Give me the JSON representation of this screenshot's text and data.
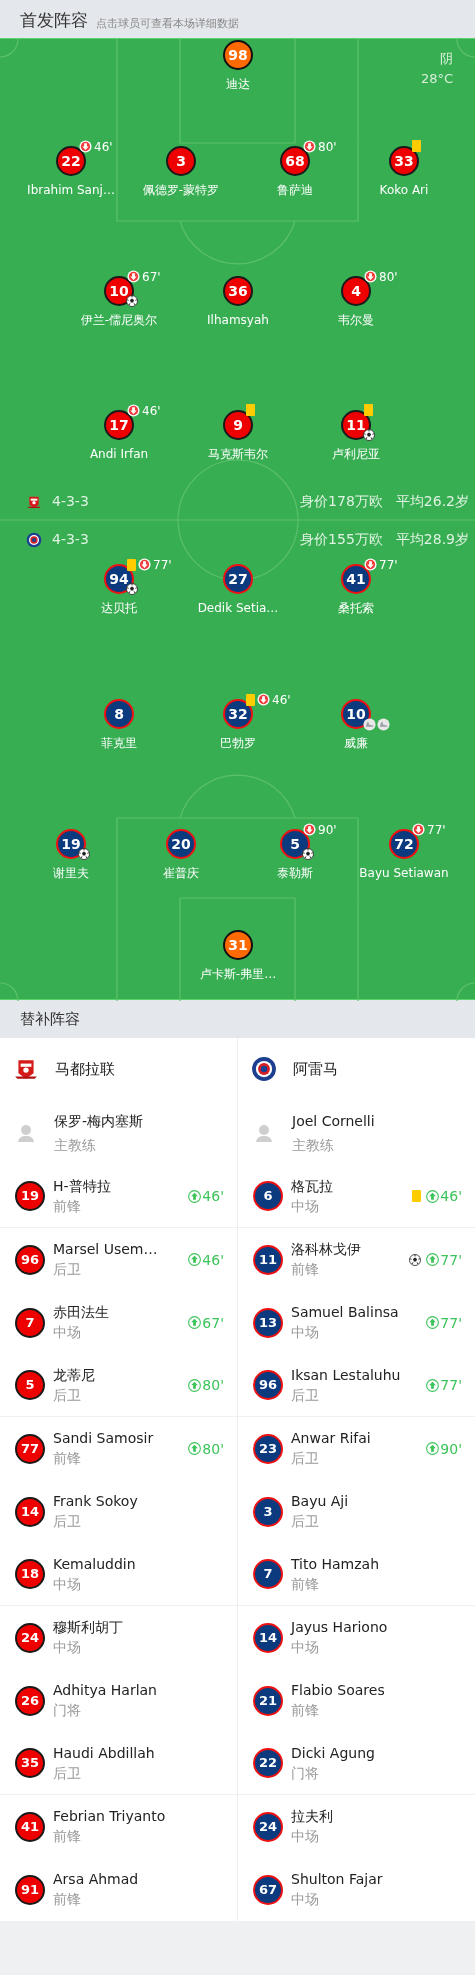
{
  "header": {
    "title": "首发阵容",
    "subtitle": "点击球员可查看本场详细数据"
  },
  "pitch": {
    "weather": "阴",
    "temperature": "28°C",
    "teams": [
      {
        "kind": "home",
        "formation": "4-3-3",
        "value": "身价178万欧",
        "age": "平均26.2岁",
        "lines": [
          {
            "players": [
              {
                "number": "98",
                "name": "迪达",
                "goalkeeper": true
              }
            ]
          },
          {
            "players": [
              {
                "number": "22",
                "name": "Ibrahim Sanj…",
                "goalkeeper": false,
                "events": [
                  {
                    "kind": "sub_out",
                    "minute": "46'"
                  }
                ]
              },
              {
                "number": "3",
                "name": "佩德罗-蒙特罗",
                "goalkeeper": false
              },
              {
                "number": "68",
                "name": "鲁萨迪",
                "goalkeeper": false,
                "events": [
                  {
                    "kind": "sub_out",
                    "minute": "80'"
                  }
                ]
              },
              {
                "number": "33",
                "name": "Koko Ari",
                "goalkeeper": false,
                "events": [
                  {
                    "kind": "yellow"
                  }
                ]
              }
            ]
          },
          {
            "players": [
              {
                "number": "10",
                "name": "伊兰-儒尼奥尔",
                "goalkeeper": false,
                "events": [
                  {
                    "kind": "sub_out",
                    "minute": "67'"
                  },
                  {
                    "kind": "goal"
                  }
                ]
              },
              {
                "number": "36",
                "name": "Ilhamsyah",
                "goalkeeper": false
              },
              {
                "number": "4",
                "name": "韦尔曼",
                "goalkeeper": false,
                "events": [
                  {
                    "kind": "sub_out",
                    "minute": "80'"
                  }
                ]
              }
            ]
          },
          {
            "players": [
              {
                "number": "17",
                "name": "Andi Irfan",
                "goalkeeper": false,
                "events": [
                  {
                    "kind": "sub_out",
                    "minute": "46'"
                  }
                ]
              },
              {
                "number": "9",
                "name": "马克斯韦尔",
                "goalkeeper": false,
                "events": [
                  {
                    "kind": "yellow"
                  }
                ]
              },
              {
                "number": "11",
                "name": "卢利尼亚",
                "goalkeeper": false,
                "events": [
                  {
                    "kind": "yellow"
                  },
                  {
                    "kind": "goal"
                  }
                ]
              }
            ]
          }
        ]
      },
      {
        "kind": "away",
        "formation": "4-3-3",
        "value": "身价155万欧",
        "age": "平均28.9岁",
        "lines": [
          {
            "players": [
              {
                "number": "94",
                "name": "达贝托",
                "goalkeeper": false,
                "events": [
                  {
                    "kind": "yellow"
                  },
                  {
                    "kind": "sub_out",
                    "minute": "77'"
                  },
                  {
                    "kind": "goal"
                  }
                ]
              },
              {
                "number": "27",
                "name": "Dedik Setia…",
                "goalkeeper": false
              },
              {
                "number": "41",
                "name": "桑托索",
                "goalkeeper": false,
                "events": [
                  {
                    "kind": "sub_out",
                    "minute": "77'"
                  }
                ]
              }
            ]
          },
          {
            "players": [
              {
                "number": "8",
                "name": "菲克里",
                "goalkeeper": false
              },
              {
                "number": "32",
                "name": "巴勃罗",
                "goalkeeper": false,
                "events": [
                  {
                    "kind": "yellow"
                  },
                  {
                    "kind": "sub_out",
                    "minute": "46'"
                  }
                ]
              },
              {
                "number": "10",
                "name": "威廉",
                "goalkeeper": false,
                "events": [
                  {
                    "kind": "assist"
                  },
                  {
                    "kind": "assist"
                  }
                ]
              }
            ]
          },
          {
            "players": [
              {
                "number": "19",
                "name": "谢里夫",
                "goalkeeper": false,
                "events": [
                  {
                    "kind": "goal"
                  }
                ]
              },
              {
                "number": "20",
                "name": "崔普庆",
                "goalkeeper": false
              },
              {
                "number": "5",
                "name": "泰勒斯",
                "goalkeeper": false,
                "events": [
                  {
                    "kind": "sub_out",
                    "minute": "90'"
                  },
                  {
                    "kind": "goal"
                  }
                ]
              },
              {
                "number": "72",
                "name": "Bayu Setiawan",
                "goalkeeper": false,
                "events": [
                  {
                    "kind": "sub_out",
                    "minute": "77'"
                  }
                ]
              }
            ]
          },
          {
            "players": [
              {
                "number": "31",
                "name": "卢卡斯-弗里…",
                "goalkeeper": true
              }
            ]
          }
        ]
      }
    ]
  },
  "substitutes": {
    "title": "替补阵容",
    "teams": [
      {
        "kind": "home",
        "name": "马都拉联",
        "coach": {
          "name": "保罗-梅内塞斯",
          "role": "主教练"
        },
        "players": [
          {
            "number": "19",
            "name": "H-普特拉",
            "position": "前锋",
            "events": [
              {
                "kind": "sub_in",
                "minute": "46'"
              }
            ]
          },
          {
            "number": "96",
            "name": "Marsel Usem…",
            "position": "后卫",
            "events": [
              {
                "kind": "sub_in",
                "minute": "46'"
              }
            ]
          },
          {
            "number": "7",
            "name": "赤田法生",
            "position": "中场",
            "events": [
              {
                "kind": "sub_in",
                "minute": "67'"
              }
            ]
          },
          {
            "number": "5",
            "name": "龙蒂尼",
            "position": "后卫",
            "events": [
              {
                "kind": "sub_in",
                "minute": "80'"
              }
            ]
          },
          {
            "number": "77",
            "name": "Sandi Samosir",
            "position": "前锋",
            "events": [
              {
                "kind": "sub_in",
                "minute": "80'"
              }
            ]
          },
          {
            "number": "14",
            "name": "Frank Sokoy",
            "position": "后卫"
          },
          {
            "number": "18",
            "name": "Kemaluddin",
            "position": "中场"
          },
          {
            "number": "24",
            "name": "穆斯利胡丁",
            "position": "中场"
          },
          {
            "number": "26",
            "name": "Adhitya Harlan",
            "position": "门将"
          },
          {
            "number": "35",
            "name": "Haudi Abdillah",
            "position": "后卫"
          },
          {
            "number": "41",
            "name": "Febrian Triyanto",
            "position": "前锋"
          },
          {
            "number": "91",
            "name": "Arsa Ahmad",
            "position": "前锋"
          }
        ]
      },
      {
        "kind": "away",
        "name": "阿雷马",
        "coach": {
          "name": "Joel Cornelli",
          "role": "主教练"
        },
        "players": [
          {
            "number": "6",
            "name": "格瓦拉",
            "position": "中场",
            "events": [
              {
                "kind": "yellow"
              },
              {
                "kind": "sub_in",
                "minute": "46'"
              }
            ]
          },
          {
            "number": "11",
            "name": "洛科林戈伊",
            "position": "前锋",
            "events": [
              {
                "kind": "goal"
              },
              {
                "kind": "sub_in",
                "minute": "77'"
              }
            ]
          },
          {
            "number": "13",
            "name": "Samuel Balinsa",
            "position": "中场",
            "events": [
              {
                "kind": "sub_in",
                "minute": "77'"
              }
            ]
          },
          {
            "number": "96",
            "name": "Iksan Lestaluhu",
            "position": "后卫",
            "events": [
              {
                "kind": "sub_in",
                "minute": "77'"
              }
            ]
          },
          {
            "number": "23",
            "name": "Anwar Rifai",
            "position": "后卫",
            "events": [
              {
                "kind": "sub_in",
                "minute": "90'"
              }
            ]
          },
          {
            "number": "3",
            "name": "Bayu Aji",
            "position": "后卫"
          },
          {
            "number": "7",
            "name": "Tito Hamzah",
            "position": "前锋"
          },
          {
            "number": "14",
            "name": "Jayus Hariono",
            "position": "中场"
          },
          {
            "number": "21",
            "name": "Flabio Soares",
            "position": "前锋"
          },
          {
            "number": "22",
            "name": "Dicki Agung",
            "position": "门将"
          },
          {
            "number": "24",
            "name": "拉夫利",
            "position": "中场"
          },
          {
            "number": "67",
            "name": "Shulton Fajar",
            "position": "中场"
          }
        ]
      }
    ]
  }
}
